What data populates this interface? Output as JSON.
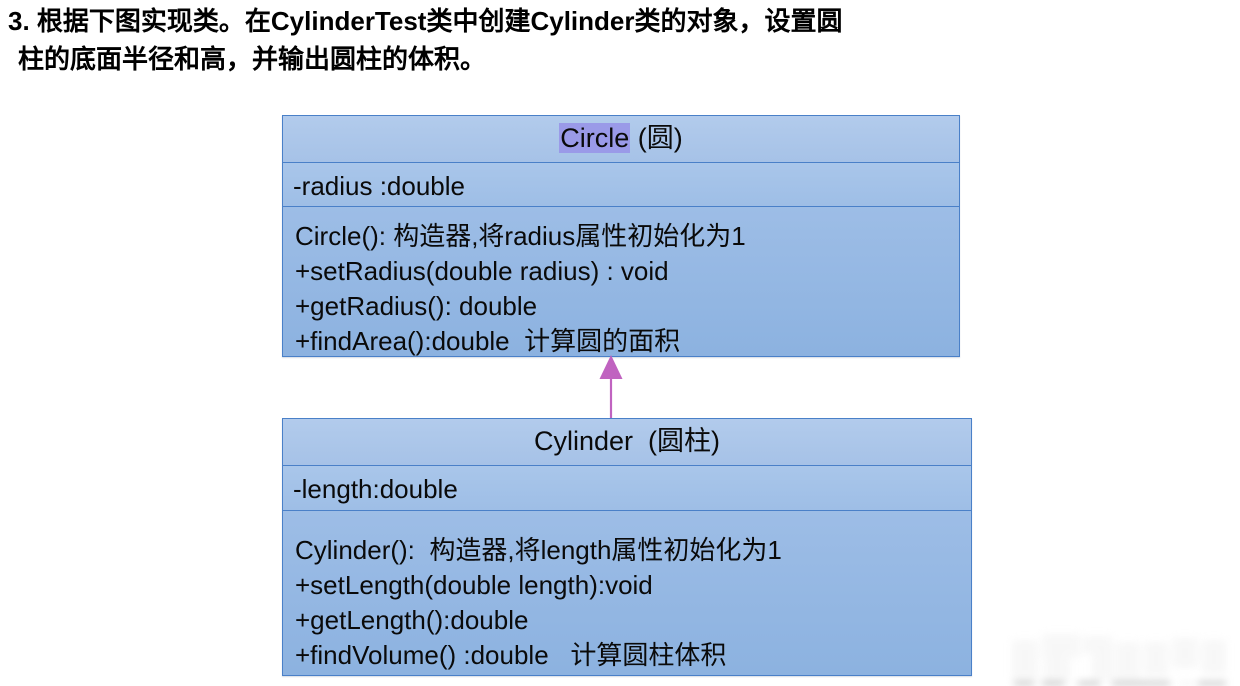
{
  "heading": {
    "line1": "3. 根据下图实现类。在CylinderTest类中创建Cylinder类的对象，设置圆",
    "line2": "柱的底面半径和高，并输出圆柱的体积。"
  },
  "diagram": {
    "type": "uml-class-diagram",
    "relationship": {
      "kind": "generalization",
      "label": "Cylinder inherits Circle",
      "arrow_color": "#c063c0",
      "from": "Cylinder",
      "to": "Circle"
    },
    "colors": {
      "box_border": "#4a80c8",
      "title_fill": "#b2cbec",
      "attrs_fill": "#a9c6ea",
      "methods_fill": "#9dbde6",
      "selection_highlight": "#9a9ae8",
      "text": "#0a0a0a"
    },
    "classes": [
      {
        "id": "circle",
        "name": "Circle",
        "name_selected": true,
        "name_suffix": " (圆)",
        "attributes": [
          "-radius :double"
        ],
        "methods": [
          "Circle(): 构造器,将radius属性初始化为1",
          "+setRadius(double radius) : void",
          "+getRadius(): double",
          "+findArea():double  计算圆的面积"
        ]
      },
      {
        "id": "cylinder",
        "name": "Cylinder",
        "name_selected": false,
        "name_suffix": "  (圆柱)",
        "attributes": [
          "-length:double"
        ],
        "methods": [
          "Cylinder():  构造器,将length属性初始化为1",
          "+setLength(double length):void",
          "+getLength():double",
          "+findVolume() :double   计算圆柱体积"
        ]
      }
    ]
  }
}
